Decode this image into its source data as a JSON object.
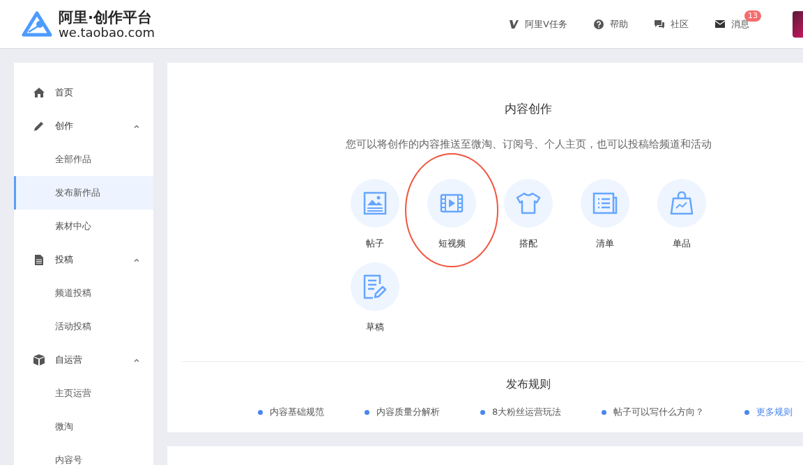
{
  "header": {
    "logo_title": "阿里·创作平台",
    "logo_domain": "we.taobao.com",
    "nav": [
      {
        "kind": "v",
        "label": "阿里V任务"
      },
      {
        "kind": "help",
        "label": "帮助"
      },
      {
        "kind": "chat",
        "label": "社区"
      },
      {
        "kind": "mail",
        "label": "消息",
        "badge": "13"
      }
    ]
  },
  "sidebar": {
    "items": [
      {
        "kind": "home",
        "label": "首页",
        "selected": false
      },
      {
        "kind": "pencil",
        "label": "创作",
        "expanded": true,
        "children": [
          {
            "label": "全部作品",
            "selected": false
          },
          {
            "label": "发布新作品",
            "selected": true
          },
          {
            "label": "素材中心",
            "selected": false
          }
        ]
      },
      {
        "kind": "doc",
        "label": "投稿",
        "expanded": true,
        "children": [
          {
            "label": "频道投稿",
            "selected": false
          },
          {
            "label": "活动投稿",
            "selected": false
          }
        ]
      },
      {
        "kind": "box",
        "label": "自运营",
        "expanded": true,
        "children": [
          {
            "label": "主页运营",
            "selected": false
          },
          {
            "label": "微淘",
            "selected": false
          },
          {
            "label": "内容号",
            "selected": false
          }
        ]
      }
    ]
  },
  "content": {
    "title": "内容创作",
    "subtitle": "您可以将创作的内容推送至微淘、订阅号、个人主页，也可以投稿给频道和活动",
    "types": [
      {
        "kind": "image",
        "label": "帖子",
        "circled": false
      },
      {
        "kind": "video",
        "label": "短视频",
        "circled": true
      },
      {
        "kind": "shirt",
        "label": "搭配",
        "circled": false
      },
      {
        "kind": "list",
        "label": "清单",
        "circled": false
      },
      {
        "kind": "bag",
        "label": "单品",
        "circled": false
      },
      {
        "kind": "draft",
        "label": "草稿",
        "circled": false
      }
    ]
  },
  "rules": {
    "title": "发布规则",
    "links": [
      {
        "label": "内容基础规范",
        "kind": "rule"
      },
      {
        "label": "内容质量分解析",
        "kind": "rule"
      },
      {
        "label": "8大粉丝运营玩法",
        "kind": "rule"
      },
      {
        "label": "帖子可以写什么方向？",
        "kind": "rule"
      },
      {
        "label": "更多规则",
        "kind": "more"
      }
    ]
  }
}
